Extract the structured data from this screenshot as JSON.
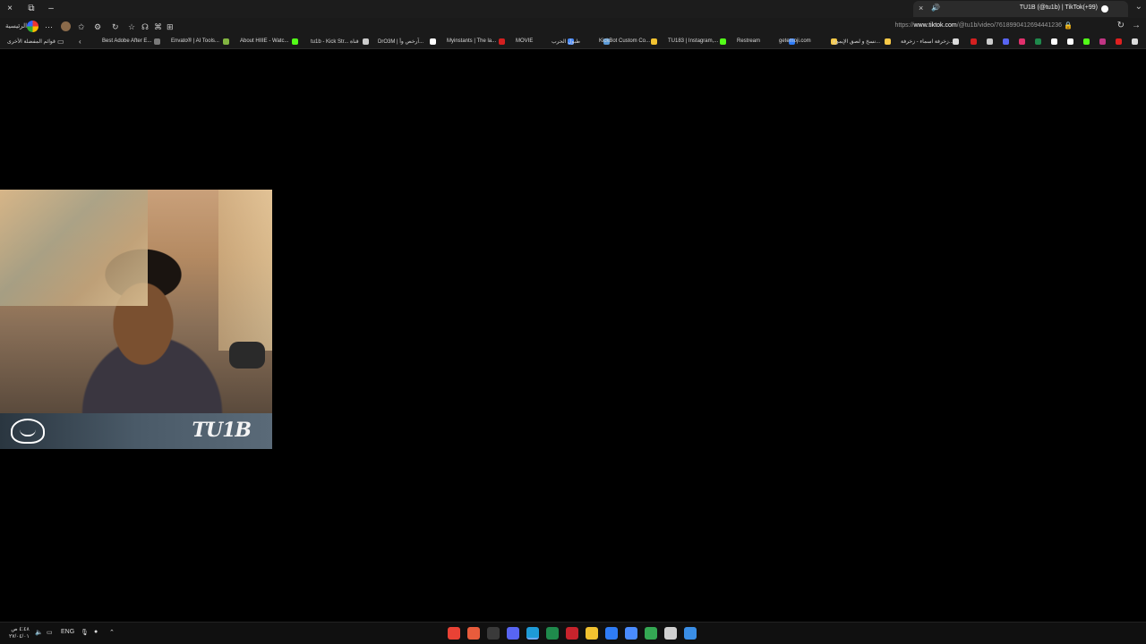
{
  "window": {
    "close_label": "×",
    "restore_label": "⧉",
    "minimize_label": "–"
  },
  "tab": {
    "title": "TU1B (@tu1b) | TikTok(+99)",
    "close_label": "×",
    "sound_label": "🔊",
    "new_tab_label": "+",
    "list_label": "⌄"
  },
  "navbar": {
    "home_label": "الرئيسية",
    "url_prefix": "https://",
    "url_host": "www.tiktok.com",
    "url_path": "/@tu1b/video/7618990412694441236",
    "reload_label": "↻",
    "forward_label": "→"
  },
  "bookmarks": {
    "other_label": "قوائم المفضلة الأخرى",
    "items": [
      {
        "label": "Best Adobe After E...",
        "color": "#7a7a7a"
      },
      {
        "label": "Envato® | AI Tools...",
        "color": "#82b541"
      },
      {
        "label": "About HIIIE - Watc...",
        "color": "#53fc18"
      },
      {
        "label": "tu1b - Kick Str... قناة",
        "color": "#cccccc"
      },
      {
        "label": "DrO3M | آرخص وأ...",
        "color": "#ffffff"
      },
      {
        "label": "Myinstants | The la...",
        "color": "#d42020"
      },
      {
        "label": "MOVIE",
        "color": "#4a8cff"
      },
      {
        "label": "طبول الحرب",
        "color": "#5a9ad8"
      },
      {
        "label": "KickBot Custom Co...",
        "color": "#f2c230"
      },
      {
        "label": "TU183 | Instagram,...",
        "color": "#53fc18"
      },
      {
        "label": "Restream",
        "color": "#2f7cf6"
      },
      {
        "label": "getemoji.com",
        "color": "#f7c948"
      },
      {
        "label": "نسخ و لصق الإيموج...",
        "color": "#f7c948"
      },
      {
        "label": "زخرفة اسماء - زخرفة...",
        "color": "#dddddd"
      }
    ]
  },
  "video": {
    "brand_text": "TU1B"
  },
  "taskbar": {
    "time": "٤:٤٨ ص",
    "date": "٢٧/٠٤/٠١",
    "language": "ENG",
    "apps": [
      {
        "name": "chrome",
        "color": "#e94235"
      },
      {
        "name": "app-red",
        "color": "#e85c3c"
      },
      {
        "name": "capcut",
        "color": "#3a3a3a"
      },
      {
        "name": "discord",
        "color": "#5865f2"
      },
      {
        "name": "edge",
        "color": "#1e9bd7"
      },
      {
        "name": "excel",
        "color": "#1f8a4c"
      },
      {
        "name": "acrobat",
        "color": "#c8232c"
      },
      {
        "name": "file-explorer",
        "color": "#f2c230"
      },
      {
        "name": "photos",
        "color": "#2f7cf6"
      },
      {
        "name": "calendar",
        "color": "#4a8cff"
      },
      {
        "name": "copilot",
        "color": "#34a853"
      },
      {
        "name": "search",
        "color": "#d0d0d0"
      },
      {
        "name": "start",
        "color": "#3a8ee6"
      }
    ]
  }
}
